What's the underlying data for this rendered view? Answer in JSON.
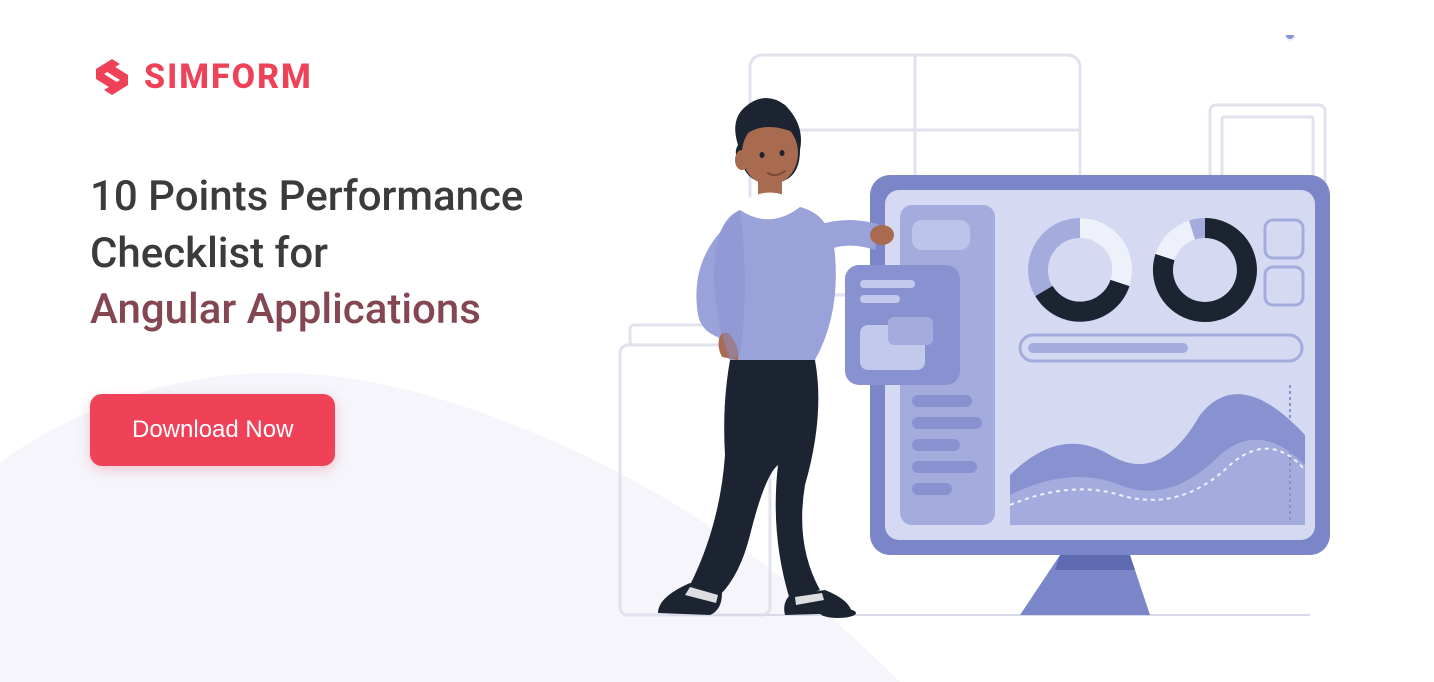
{
  "brand": {
    "name": "SIMFORM",
    "accent_color": "#EF4158"
  },
  "headline": {
    "line1": "10 Points Performance",
    "line2": "Checklist for",
    "line3_accent": "Angular Applications"
  },
  "cta": {
    "label": "Download Now"
  },
  "colors": {
    "text_primary": "#3B3B3B",
    "text_accent": "#844651",
    "button_bg": "#EF4158",
    "wave_bg": "#F5F5FB",
    "illustration_primary": "#8892D0",
    "illustration_light": "#C3C9EA",
    "illustration_dark": "#1B2430"
  }
}
